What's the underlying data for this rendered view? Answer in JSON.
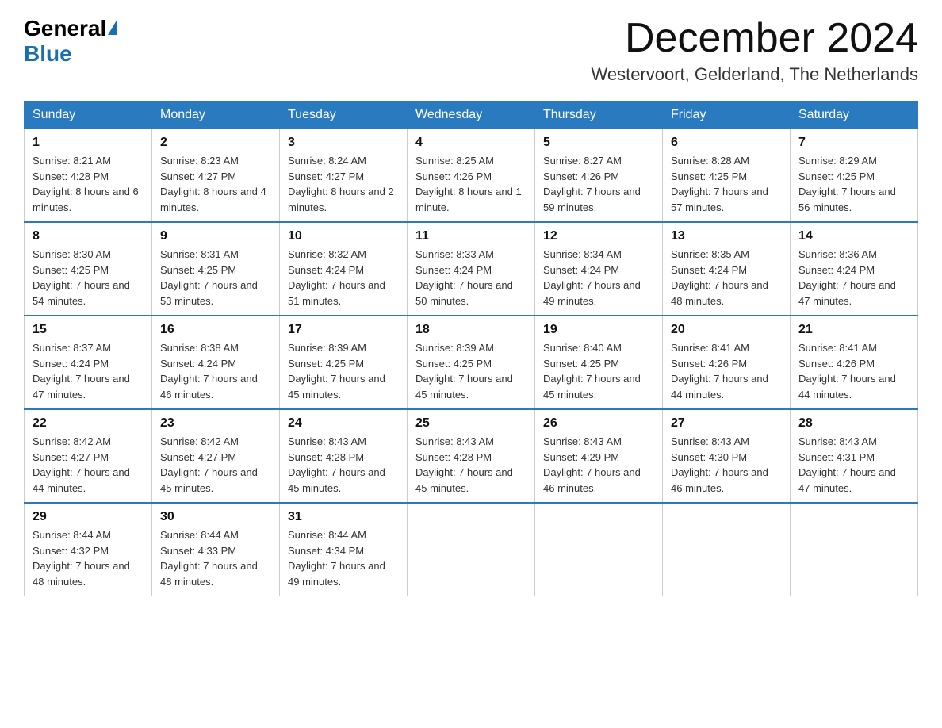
{
  "logo": {
    "general": "General",
    "blue": "Blue"
  },
  "title": "December 2024",
  "subtitle": "Westervoort, Gelderland, The Netherlands",
  "days_of_week": [
    "Sunday",
    "Monday",
    "Tuesday",
    "Wednesday",
    "Thursday",
    "Friday",
    "Saturday"
  ],
  "weeks": [
    [
      {
        "day": "1",
        "sunrise": "8:21 AM",
        "sunset": "4:28 PM",
        "daylight": "8 hours and 6 minutes."
      },
      {
        "day": "2",
        "sunrise": "8:23 AM",
        "sunset": "4:27 PM",
        "daylight": "8 hours and 4 minutes."
      },
      {
        "day": "3",
        "sunrise": "8:24 AM",
        "sunset": "4:27 PM",
        "daylight": "8 hours and 2 minutes."
      },
      {
        "day": "4",
        "sunrise": "8:25 AM",
        "sunset": "4:26 PM",
        "daylight": "8 hours and 1 minute."
      },
      {
        "day": "5",
        "sunrise": "8:27 AM",
        "sunset": "4:26 PM",
        "daylight": "7 hours and 59 minutes."
      },
      {
        "day": "6",
        "sunrise": "8:28 AM",
        "sunset": "4:25 PM",
        "daylight": "7 hours and 57 minutes."
      },
      {
        "day": "7",
        "sunrise": "8:29 AM",
        "sunset": "4:25 PM",
        "daylight": "7 hours and 56 minutes."
      }
    ],
    [
      {
        "day": "8",
        "sunrise": "8:30 AM",
        "sunset": "4:25 PM",
        "daylight": "7 hours and 54 minutes."
      },
      {
        "day": "9",
        "sunrise": "8:31 AM",
        "sunset": "4:25 PM",
        "daylight": "7 hours and 53 minutes."
      },
      {
        "day": "10",
        "sunrise": "8:32 AM",
        "sunset": "4:24 PM",
        "daylight": "7 hours and 51 minutes."
      },
      {
        "day": "11",
        "sunrise": "8:33 AM",
        "sunset": "4:24 PM",
        "daylight": "7 hours and 50 minutes."
      },
      {
        "day": "12",
        "sunrise": "8:34 AM",
        "sunset": "4:24 PM",
        "daylight": "7 hours and 49 minutes."
      },
      {
        "day": "13",
        "sunrise": "8:35 AM",
        "sunset": "4:24 PM",
        "daylight": "7 hours and 48 minutes."
      },
      {
        "day": "14",
        "sunrise": "8:36 AM",
        "sunset": "4:24 PM",
        "daylight": "7 hours and 47 minutes."
      }
    ],
    [
      {
        "day": "15",
        "sunrise": "8:37 AM",
        "sunset": "4:24 PM",
        "daylight": "7 hours and 47 minutes."
      },
      {
        "day": "16",
        "sunrise": "8:38 AM",
        "sunset": "4:24 PM",
        "daylight": "7 hours and 46 minutes."
      },
      {
        "day": "17",
        "sunrise": "8:39 AM",
        "sunset": "4:25 PM",
        "daylight": "7 hours and 45 minutes."
      },
      {
        "day": "18",
        "sunrise": "8:39 AM",
        "sunset": "4:25 PM",
        "daylight": "7 hours and 45 minutes."
      },
      {
        "day": "19",
        "sunrise": "8:40 AM",
        "sunset": "4:25 PM",
        "daylight": "7 hours and 45 minutes."
      },
      {
        "day": "20",
        "sunrise": "8:41 AM",
        "sunset": "4:26 PM",
        "daylight": "7 hours and 44 minutes."
      },
      {
        "day": "21",
        "sunrise": "8:41 AM",
        "sunset": "4:26 PM",
        "daylight": "7 hours and 44 minutes."
      }
    ],
    [
      {
        "day": "22",
        "sunrise": "8:42 AM",
        "sunset": "4:27 PM",
        "daylight": "7 hours and 44 minutes."
      },
      {
        "day": "23",
        "sunrise": "8:42 AM",
        "sunset": "4:27 PM",
        "daylight": "7 hours and 45 minutes."
      },
      {
        "day": "24",
        "sunrise": "8:43 AM",
        "sunset": "4:28 PM",
        "daylight": "7 hours and 45 minutes."
      },
      {
        "day": "25",
        "sunrise": "8:43 AM",
        "sunset": "4:28 PM",
        "daylight": "7 hours and 45 minutes."
      },
      {
        "day": "26",
        "sunrise": "8:43 AM",
        "sunset": "4:29 PM",
        "daylight": "7 hours and 46 minutes."
      },
      {
        "day": "27",
        "sunrise": "8:43 AM",
        "sunset": "4:30 PM",
        "daylight": "7 hours and 46 minutes."
      },
      {
        "day": "28",
        "sunrise": "8:43 AM",
        "sunset": "4:31 PM",
        "daylight": "7 hours and 47 minutes."
      }
    ],
    [
      {
        "day": "29",
        "sunrise": "8:44 AM",
        "sunset": "4:32 PM",
        "daylight": "7 hours and 48 minutes."
      },
      {
        "day": "30",
        "sunrise": "8:44 AM",
        "sunset": "4:33 PM",
        "daylight": "7 hours and 48 minutes."
      },
      {
        "day": "31",
        "sunrise": "8:44 AM",
        "sunset": "4:34 PM",
        "daylight": "7 hours and 49 minutes."
      },
      null,
      null,
      null,
      null
    ]
  ]
}
